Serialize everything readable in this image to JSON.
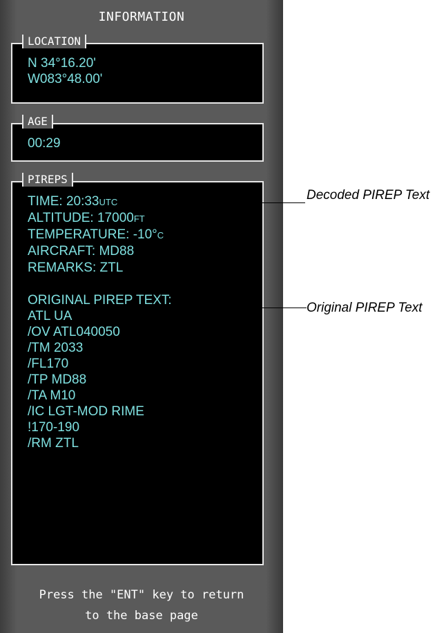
{
  "window": {
    "title": "INFORMATION"
  },
  "location": {
    "label": "LOCATION",
    "lat": "N 34°16.20'",
    "lon": "W083°48.00'"
  },
  "age": {
    "label": "AGE",
    "value": "00:29"
  },
  "pireps": {
    "label": "PIREPS",
    "decoded": [
      {
        "text": "TIME: 20:33",
        "unit": "UTC"
      },
      {
        "text": "ALTITUDE: 17000",
        "unit": "FT"
      },
      {
        "text": "TEMPERATURE: -10°",
        "unit": "C"
      },
      {
        "text": "AIRCRAFT: MD88",
        "unit": ""
      },
      {
        "text": "REMARKS: ZTL",
        "unit": ""
      }
    ],
    "original_heading": "ORIGINAL PIREP TEXT:",
    "original": [
      "ATL UA",
      "/OV ATL040050",
      "/TM 2033",
      "/FL170",
      "/TP MD88",
      "/TA M10",
      "/IC LGT-MOD RIME",
      "!170-190",
      "/RM ZTL"
    ]
  },
  "footer": {
    "line1": "Press the \"ENT\" key to return",
    "line2": "to the base page"
  },
  "callouts": {
    "decoded": "Decoded PIREP Text",
    "original": "Original PIREP Text"
  }
}
